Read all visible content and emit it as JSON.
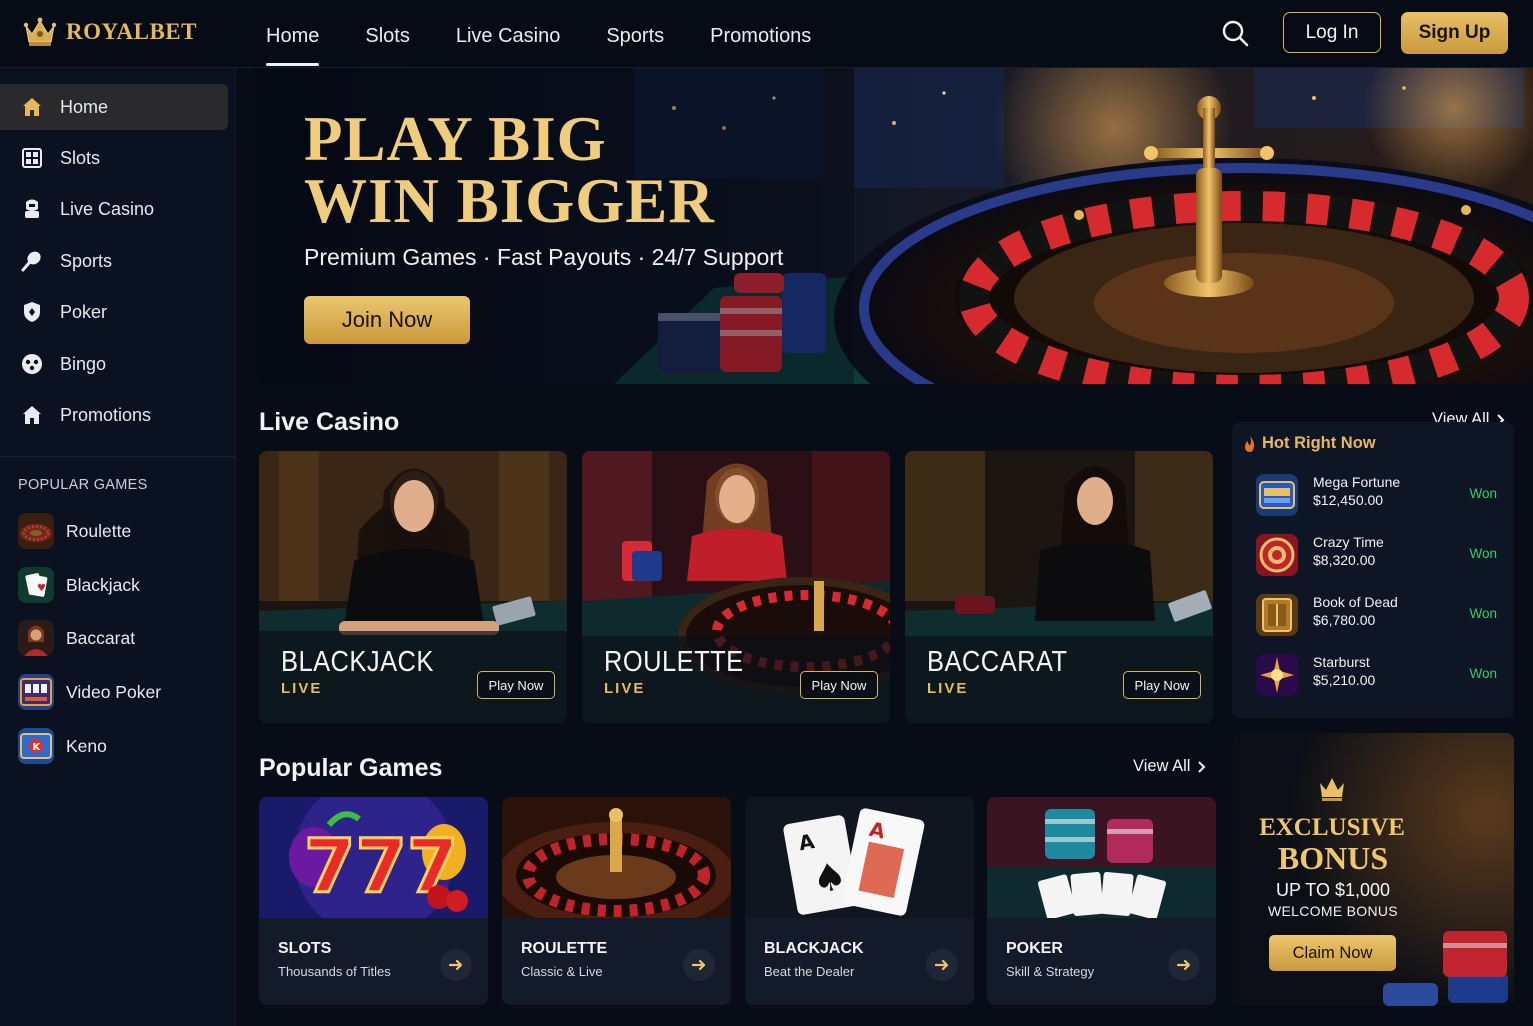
{
  "brand": {
    "name": "ROYALBET"
  },
  "nav": {
    "items": [
      "Home",
      "Slots",
      "Live Casino",
      "Sports",
      "Promotions"
    ],
    "active": "Home"
  },
  "header": {
    "login_label": "Log In",
    "signup_label": "Sign Up"
  },
  "sidebar": {
    "items": [
      {
        "label": "Home",
        "icon": "home-icon"
      },
      {
        "label": "Slots",
        "icon": "slots-grid-icon"
      },
      {
        "label": "Live Casino",
        "icon": "dealer-icon"
      },
      {
        "label": "Sports",
        "icon": "racket-icon"
      },
      {
        "label": "Poker",
        "icon": "poker-shield-icon"
      },
      {
        "label": "Bingo",
        "icon": "bingo-ball-icon"
      },
      {
        "label": "Promotions",
        "icon": "promotions-house-icon"
      }
    ],
    "popular_heading": "POPULAR GAMES",
    "popular": [
      "Roulette",
      "Blackjack",
      "Baccarat",
      "Video Poker",
      "Keno"
    ]
  },
  "hero": {
    "title_line1": "PLAY BIG",
    "title_line2": "WIN BIGGER",
    "subtitle": "Premium Games · Fast Payouts · 24/7 Support",
    "cta": "Join Now"
  },
  "live_casino": {
    "title": "Live Casino",
    "view_all": "View All",
    "cards": [
      {
        "name": "BLACKJACK",
        "tag": "LIVE",
        "button": "Play Now"
      },
      {
        "name": "ROULETTE",
        "tag": "LIVE",
        "button": "Play Now"
      },
      {
        "name": "BACCARAT",
        "tag": "LIVE",
        "button": "Play Now"
      }
    ]
  },
  "hot": {
    "title": "Hot Right Now",
    "rows": [
      {
        "game": "Mega Fortune",
        "amount": "$12,450.00",
        "status": "Won"
      },
      {
        "game": "Crazy Time",
        "amount": "$8,320.00",
        "status": "Won"
      },
      {
        "game": "Book of Dead",
        "amount": "$6,780.00",
        "status": "Won"
      },
      {
        "game": "Starburst",
        "amount": "$5,210.00",
        "status": "Won"
      }
    ]
  },
  "popular_games": {
    "title": "Popular Games",
    "view_all": "View All",
    "cards": [
      {
        "name": "SLOTS",
        "sub": "Thousands of Titles"
      },
      {
        "name": "ROULETTE",
        "sub": "Classic & Live"
      },
      {
        "name": "BLACKJACK",
        "sub": "Beat the Dealer"
      },
      {
        "name": "POKER",
        "sub": "Skill & Strategy"
      }
    ]
  },
  "bonus": {
    "line1": "EXCLUSIVE",
    "line2": "BONUS",
    "amount": "UP TO $1,000",
    "caption": "WELCOME BONUS",
    "cta": "Claim Now"
  },
  "colors": {
    "gold": "#e3b95a",
    "background": "#070c17",
    "won_green": "#3fc96a"
  }
}
